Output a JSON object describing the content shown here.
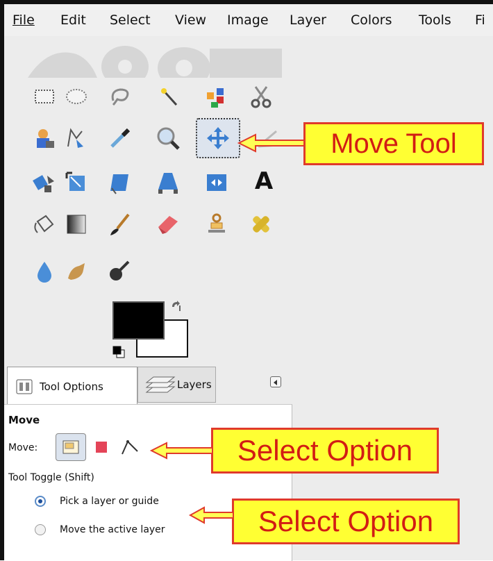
{
  "menubar": {
    "items": [
      {
        "label": "File",
        "mnemonic_index": 0
      },
      {
        "label": "Edit",
        "mnemonic_index": 0
      },
      {
        "label": "Select",
        "mnemonic_index": 0
      },
      {
        "label": "View",
        "mnemonic_index": 0
      },
      {
        "label": "Image",
        "mnemonic_index": 0
      },
      {
        "label": "Layer",
        "mnemonic_index": 0
      },
      {
        "label": "Colors",
        "mnemonic_index": 0
      },
      {
        "label": "Tools",
        "mnemonic_index": 0
      },
      {
        "label": "Fi",
        "mnemonic_index": 0
      }
    ]
  },
  "toolbox": {
    "rows": [
      [
        "rect-select-icon",
        "ellipse-select-icon",
        "free-select-icon",
        "fuzzy-select-icon",
        "color-select-icon",
        "scissors-select-icon"
      ],
      [
        "foreground-select-icon",
        "paths-icon",
        "color-picker-icon",
        "zoom-icon",
        "move-icon",
        "measure-icon"
      ],
      [
        "align-icon",
        "crop-icon",
        "rotate-icon",
        "perspective-icon",
        "flip-icon",
        "text-icon"
      ],
      [
        "bucket-fill-icon",
        "gradient-icon",
        "paintbrush-icon",
        "eraser-icon",
        "clone-icon",
        "heal-icon"
      ],
      [
        "blur-icon",
        "smudge-icon",
        "dodge-burn-icon"
      ]
    ],
    "active_tool": "move-icon",
    "text_tool_glyph": "A"
  },
  "colors": {
    "foreground": "#000000",
    "background": "#ffffff",
    "callout_fill": "#ffff33",
    "callout_text": "#d21c14"
  },
  "callouts": {
    "move_tool": "Move Tool",
    "select_option_1": "Select Option",
    "select_option_2": "Select Option"
  },
  "dock": {
    "tabs": [
      {
        "label": "Tool Options",
        "icon": "tool-options-icon",
        "active": true
      },
      {
        "label": "Layers",
        "icon": "layers-icon",
        "active": false
      }
    ],
    "menu_icon": "dock-menu-arrow-icon"
  },
  "tool_options": {
    "title": "Move",
    "move_label": "Move:",
    "move_modes": [
      {
        "icon": "layer-mode-icon",
        "selected": true
      },
      {
        "icon": "selection-mode-icon",
        "selected": false
      },
      {
        "icon": "path-mode-icon",
        "selected": false
      }
    ],
    "toggle_label": "Tool Toggle  (Shift)",
    "options": [
      {
        "label": "Pick a layer or guide",
        "selected": true
      },
      {
        "label": "Move the active layer",
        "selected": false
      }
    ]
  }
}
